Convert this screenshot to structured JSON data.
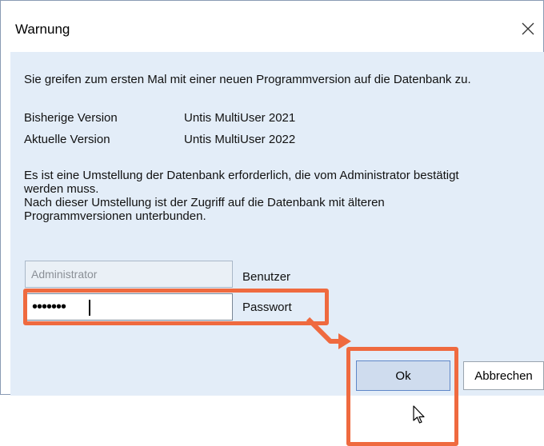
{
  "dialog": {
    "title": "Warnung",
    "close_icon": "close-icon",
    "intro": "Sie greifen zum ersten Mal mit einer neuen Programmversion auf die Datenbank zu.",
    "versions": [
      {
        "label": "Bisherige Version",
        "value": "Untis MultiUser 2021"
      },
      {
        "label": "Aktuelle Version",
        "value": "Untis MultiUser 2022"
      }
    ],
    "message_lines": [
      "Es ist eine Umstellung der Datenbank erforderlich, die vom Administrator bestätigt",
      "werden muss.",
      "Nach dieser Umstellung ist der Zugriff auf die Datenbank mit älteren",
      "Programmversionen unterbunden."
    ],
    "user_field": {
      "value": "Administrator",
      "label": "Benutzer"
    },
    "password_field": {
      "value": "•••••••",
      "label": "Passwort"
    },
    "buttons": {
      "ok": "Ok",
      "cancel": "Abbrechen"
    },
    "highlight_color": "#ef6a3f",
    "accent_color": "#5f87c8"
  }
}
